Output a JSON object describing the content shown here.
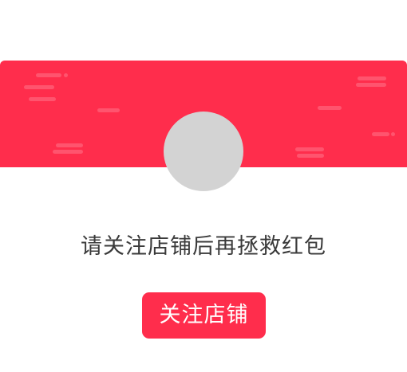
{
  "dialog": {
    "message": "请关注店铺后再拯救红包",
    "follow_button_label": "关注店铺"
  },
  "colors": {
    "accent": "#ff2d4c",
    "avatar_placeholder": "#d3d3d3",
    "text": "#3a3a3a"
  }
}
